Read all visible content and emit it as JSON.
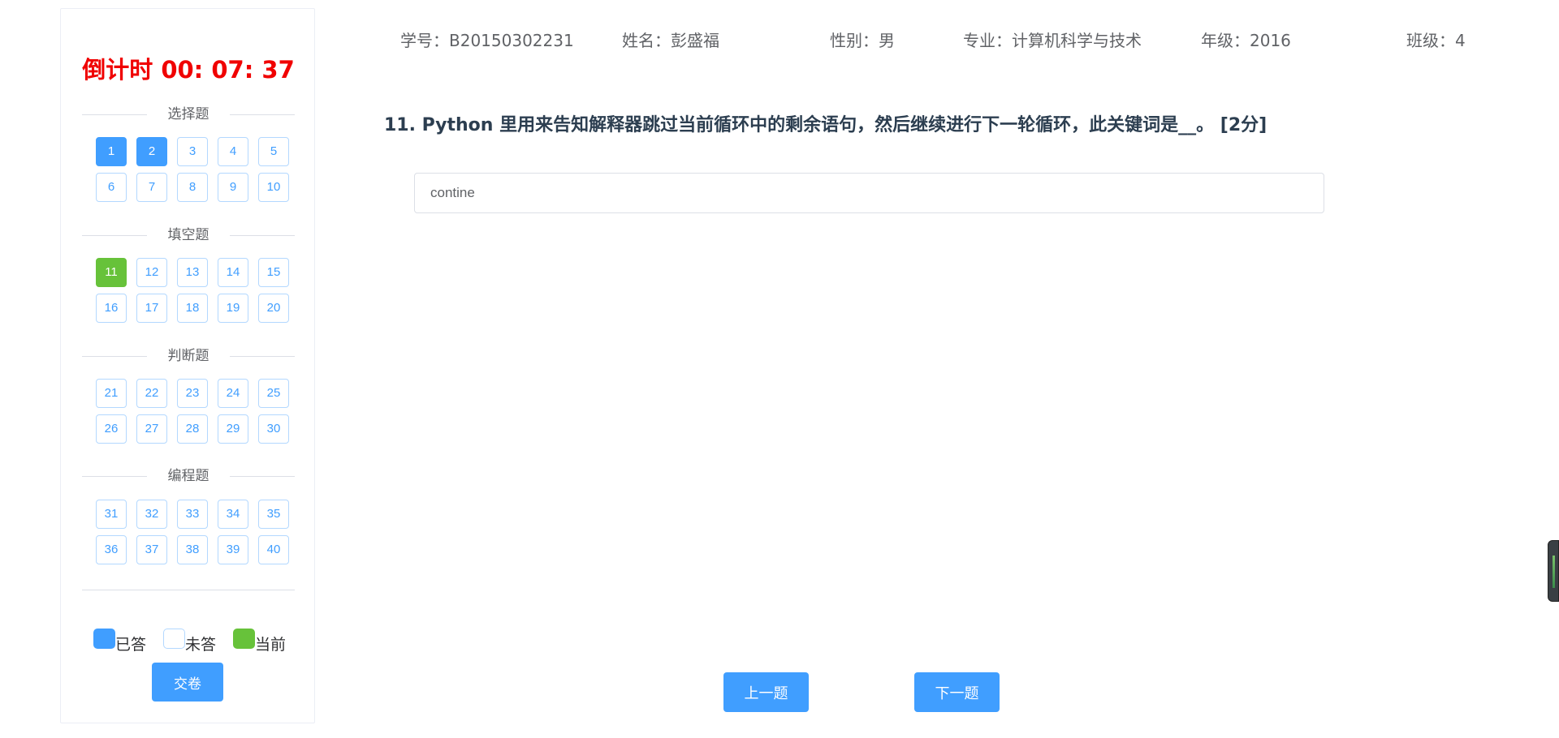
{
  "timer": {
    "label": "倒计时",
    "time": "00: 07: 37"
  },
  "sections": [
    {
      "title": "选择题",
      "questions": [
        {
          "n": "1",
          "state": "answered"
        },
        {
          "n": "2",
          "state": "answered"
        },
        {
          "n": "3",
          "state": "unanswered"
        },
        {
          "n": "4",
          "state": "unanswered"
        },
        {
          "n": "5",
          "state": "unanswered"
        },
        {
          "n": "6",
          "state": "unanswered"
        },
        {
          "n": "7",
          "state": "unanswered"
        },
        {
          "n": "8",
          "state": "unanswered"
        },
        {
          "n": "9",
          "state": "unanswered"
        },
        {
          "n": "10",
          "state": "unanswered"
        }
      ]
    },
    {
      "title": "填空题",
      "questions": [
        {
          "n": "11",
          "state": "current"
        },
        {
          "n": "12",
          "state": "unanswered"
        },
        {
          "n": "13",
          "state": "unanswered"
        },
        {
          "n": "14",
          "state": "unanswered"
        },
        {
          "n": "15",
          "state": "unanswered"
        },
        {
          "n": "16",
          "state": "unanswered"
        },
        {
          "n": "17",
          "state": "unanswered"
        },
        {
          "n": "18",
          "state": "unanswered"
        },
        {
          "n": "19",
          "state": "unanswered"
        },
        {
          "n": "20",
          "state": "unanswered"
        }
      ]
    },
    {
      "title": "判断题",
      "questions": [
        {
          "n": "21",
          "state": "unanswered"
        },
        {
          "n": "22",
          "state": "unanswered"
        },
        {
          "n": "23",
          "state": "unanswered"
        },
        {
          "n": "24",
          "state": "unanswered"
        },
        {
          "n": "25",
          "state": "unanswered"
        },
        {
          "n": "26",
          "state": "unanswered"
        },
        {
          "n": "27",
          "state": "unanswered"
        },
        {
          "n": "28",
          "state": "unanswered"
        },
        {
          "n": "29",
          "state": "unanswered"
        },
        {
          "n": "30",
          "state": "unanswered"
        }
      ]
    },
    {
      "title": "编程题",
      "questions": [
        {
          "n": "31",
          "state": "unanswered"
        },
        {
          "n": "32",
          "state": "unanswered"
        },
        {
          "n": "33",
          "state": "unanswered"
        },
        {
          "n": "34",
          "state": "unanswered"
        },
        {
          "n": "35",
          "state": "unanswered"
        },
        {
          "n": "36",
          "state": "unanswered"
        },
        {
          "n": "37",
          "state": "unanswered"
        },
        {
          "n": "38",
          "state": "unanswered"
        },
        {
          "n": "39",
          "state": "unanswered"
        },
        {
          "n": "40",
          "state": "unanswered"
        }
      ]
    }
  ],
  "legend": {
    "answered": "已答",
    "unanswered": "未答",
    "current": "当前"
  },
  "submit_label": "交卷",
  "student": {
    "id": "学号：B20150302231",
    "name": "姓名：彭盛福",
    "gender": "性别：男",
    "major": "专业：计算机科学与技术",
    "grade": "年级：2016",
    "class": "班级：4"
  },
  "question_text": "11. Python 里用来告知解释器跳过当前循环中的剩余语句，然后继续进行下一轮循环，此关键词是__。 [2分]",
  "answer_value": "contine",
  "nav": {
    "prev": "上一题",
    "next": "下一题"
  },
  "colors": {
    "answered": "#409eff",
    "current": "#67c23a",
    "timer": "#f00000"
  }
}
